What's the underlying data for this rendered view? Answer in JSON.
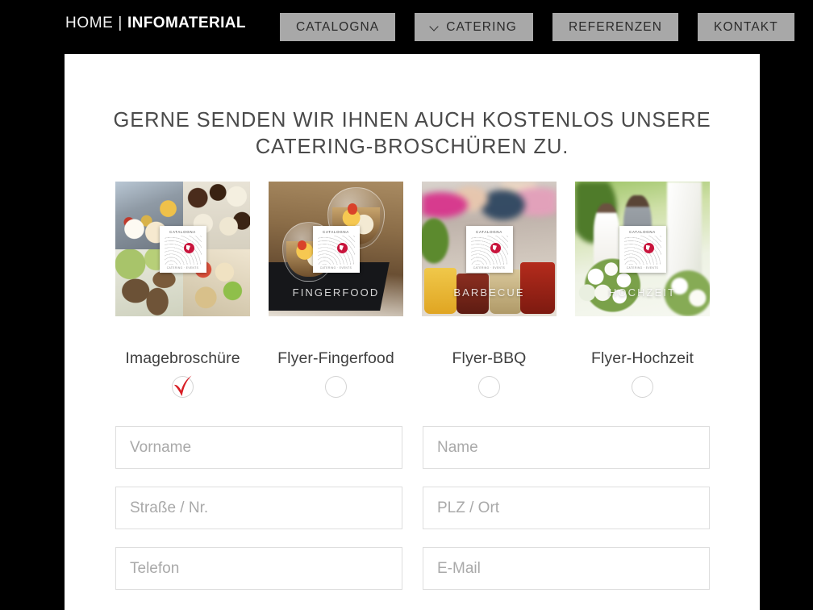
{
  "header": {
    "breadcrumb_home": "HOME",
    "breadcrumb_separator": "|",
    "breadcrumb_current": "INFOMATERIAL",
    "nav": [
      {
        "label": "CATALOGNA",
        "has_chevron": false
      },
      {
        "label": "CATERING",
        "has_chevron": true
      },
      {
        "label": "REFERENZEN",
        "has_chevron": false
      },
      {
        "label": "KONTAKT",
        "has_chevron": false
      }
    ]
  },
  "main": {
    "headline_line1": "GERNE SENDEN WIR IHNEN AUCH KOSTENLOS UNSERE",
    "headline_line2": "CATERING-BROSCHÜREN ZU.",
    "brochures": [
      {
        "label": "Imagebroschüre",
        "overlay_caption": "",
        "selected": true,
        "cover_title": "CATALOGNA",
        "cover_footer": "CATERING · EVENTS"
      },
      {
        "label": "Flyer-Fingerfood",
        "overlay_caption": "FINGERFOOD",
        "selected": false,
        "cover_title": "CATALOGNA",
        "cover_footer": "CATERING · EVENTS"
      },
      {
        "label": "Flyer-BBQ",
        "overlay_caption": "BARBECUE",
        "selected": false,
        "cover_title": "CATALOGNA",
        "cover_footer": "CATERING · EVENTS"
      },
      {
        "label": "Flyer-Hochzeit",
        "overlay_caption": "HOCHZEIT",
        "selected": false,
        "cover_title": "CATALOGNA",
        "cover_footer": "CATERING · EVENTS"
      }
    ],
    "form": {
      "first_name": {
        "placeholder": "Vorname",
        "value": ""
      },
      "last_name": {
        "placeholder": "Name",
        "value": ""
      },
      "street": {
        "placeholder": "Straße / Nr.",
        "value": ""
      },
      "city": {
        "placeholder": "PLZ / Ort",
        "value": ""
      },
      "phone": {
        "placeholder": "Telefon",
        "value": ""
      },
      "email": {
        "placeholder": "E-Mail",
        "value": ""
      }
    }
  },
  "colors": {
    "page_background": "#000000",
    "content_background": "#ffffff",
    "nav_button": "#a8a8a8",
    "nav_button_text": "#2b2b2b",
    "headline_text": "#4a4a4a",
    "check_red": "#d81f26",
    "brand_red": "#c8143c",
    "field_border": "#dedede",
    "placeholder_text": "#a9a9a9"
  }
}
